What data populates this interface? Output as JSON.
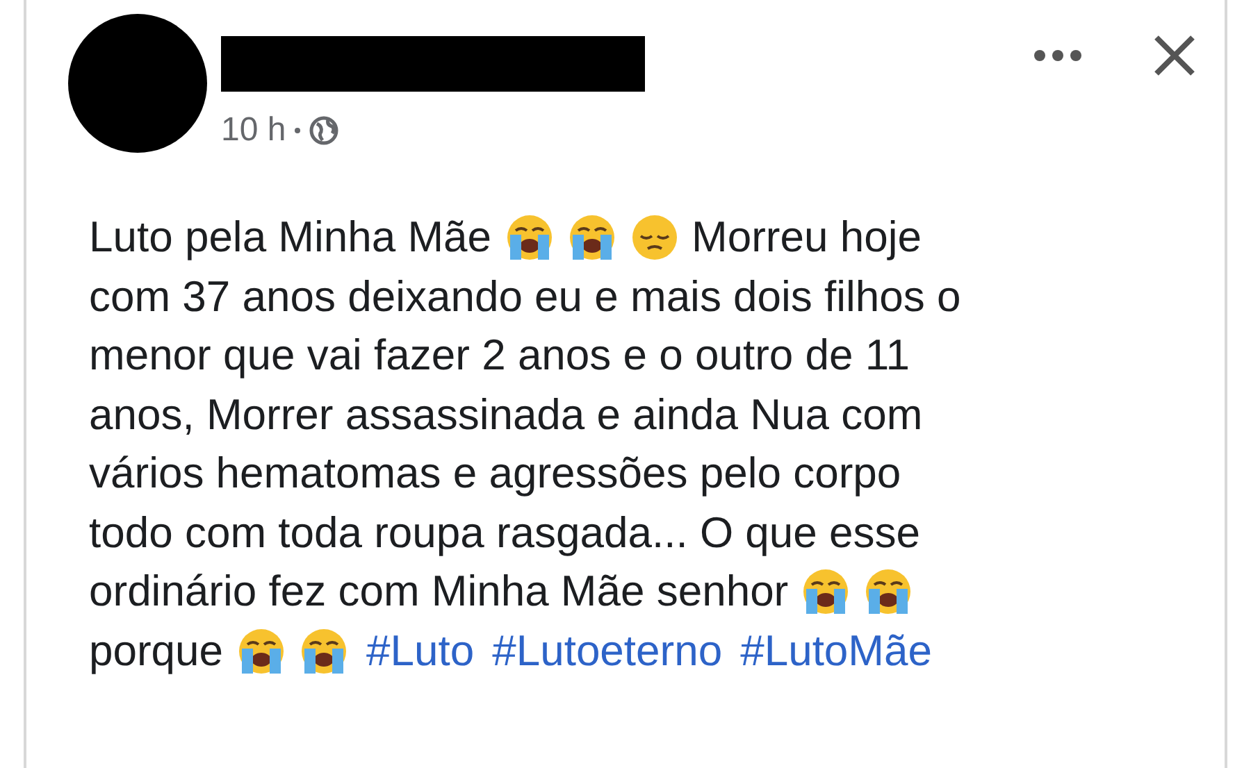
{
  "post": {
    "time": "10 h",
    "lines": [
      [
        {
          "kind": "text",
          "text": "Luto pela Minha Mãe"
        },
        {
          "kind": "crying-emoji"
        },
        {
          "kind": "crying-emoji"
        },
        {
          "kind": "pensive-emoji"
        },
        {
          "kind": "text",
          "text": "Morreu hoje"
        }
      ],
      [
        {
          "kind": "text",
          "text": "com 37 anos deixando eu e mais dois filhos o"
        }
      ],
      [
        {
          "kind": "text",
          "text": "menor que vai fazer 2 anos e o outro de 11"
        }
      ],
      [
        {
          "kind": "text",
          "text": "anos, Morrer assassinada e ainda Nua com"
        }
      ],
      [
        {
          "kind": "text",
          "text": "vários hematomas e agressões pelo corpo"
        }
      ],
      [
        {
          "kind": "text",
          "text": "todo com toda roupa rasgada... O que esse"
        }
      ],
      [
        {
          "kind": "text",
          "text": "ordinário fez com Minha Mãe senhor"
        },
        {
          "kind": "crying-emoji"
        },
        {
          "kind": "crying-emoji"
        }
      ],
      [
        {
          "kind": "text",
          "text": "porque"
        },
        {
          "kind": "crying-emoji"
        },
        {
          "kind": "crying-emoji"
        },
        {
          "kind": "hashtag",
          "text": "#Luto"
        },
        {
          "kind": "hashtag",
          "text": "#Lutoeterno"
        },
        {
          "kind": "hashtag",
          "text": "#LutoMãe"
        }
      ]
    ]
  }
}
